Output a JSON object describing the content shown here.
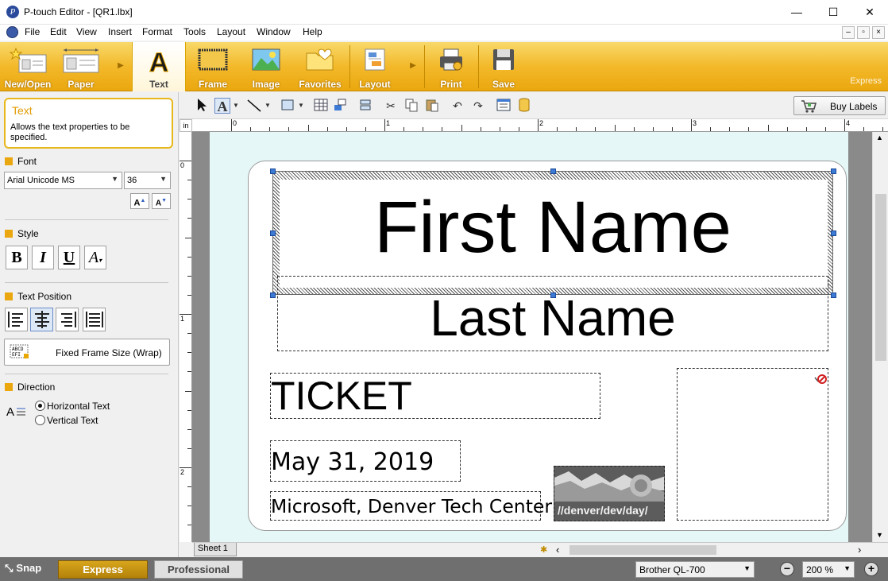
{
  "window": {
    "title": "P-touch Editor - [QR1.lbx]",
    "minimize_glyph": "—",
    "maximize_glyph": "☐",
    "close_glyph": "✕"
  },
  "menu": [
    "File",
    "Edit",
    "View",
    "Insert",
    "Format",
    "Tools",
    "Layout",
    "Window",
    "Help"
  ],
  "mdi": {
    "minimize": "–",
    "restore": "▫",
    "close": "×"
  },
  "ribbon": {
    "buttons": [
      {
        "label": "New/Open",
        "icon": "new-open-icon"
      },
      {
        "label": "Paper",
        "icon": "paper-icon"
      },
      {
        "label": "Text",
        "icon": "text-icon",
        "active": true
      },
      {
        "label": "Frame",
        "icon": "frame-icon"
      },
      {
        "label": "Image",
        "icon": "image-icon"
      },
      {
        "label": "Favorites",
        "icon": "favorites-icon"
      },
      {
        "label": "Layout",
        "icon": "layout-icon"
      },
      {
        "label": "Print",
        "icon": "print-icon"
      },
      {
        "label": "Save",
        "icon": "save-icon"
      }
    ],
    "mode_label": "Express"
  },
  "properties": {
    "title": "Text",
    "description": "Allows the text properties to be specified.",
    "font": {
      "header": "Font",
      "family": "Arial Unicode MS",
      "size": "36"
    },
    "style": {
      "header": "Style",
      "bold": "B",
      "italic": "I",
      "underline": "U",
      "effects": "A"
    },
    "text_position": {
      "header": "Text Position",
      "fixed_frame_label": "Fixed Frame Size (Wrap)"
    },
    "direction": {
      "header": "Direction",
      "options": [
        {
          "label": "Horizontal Text",
          "selected": true
        },
        {
          "label": "Vertical Text",
          "selected": false
        }
      ]
    }
  },
  "toolbar": {
    "buy_labels": "Buy Labels"
  },
  "rulers": {
    "corner": "in",
    "h_numbers": [
      "0",
      "1",
      "2",
      "3",
      "4"
    ],
    "v_numbers": [
      "0",
      "1",
      "2"
    ]
  },
  "label": {
    "first_name": "First Name",
    "last_name": "Last Name",
    "ticket": "TICKET",
    "date": "May 31, 2019",
    "location": "Microsoft, Denver Tech Center",
    "image_caption": "//denver/dev/day/"
  },
  "sheet_tab": "Sheet 1",
  "status": {
    "snap": "Snap",
    "express": "Express",
    "professional": "Professional",
    "printer": "Brother QL-700",
    "zoom": "200 %",
    "zoom_out": "−",
    "zoom_in": "+"
  },
  "colors": {
    "ribbon_accent": "#f3b92a",
    "express_active": "#d8a51c",
    "selection_handle": "#3d7ad4",
    "canvas_bg": "#e6f7f8"
  }
}
